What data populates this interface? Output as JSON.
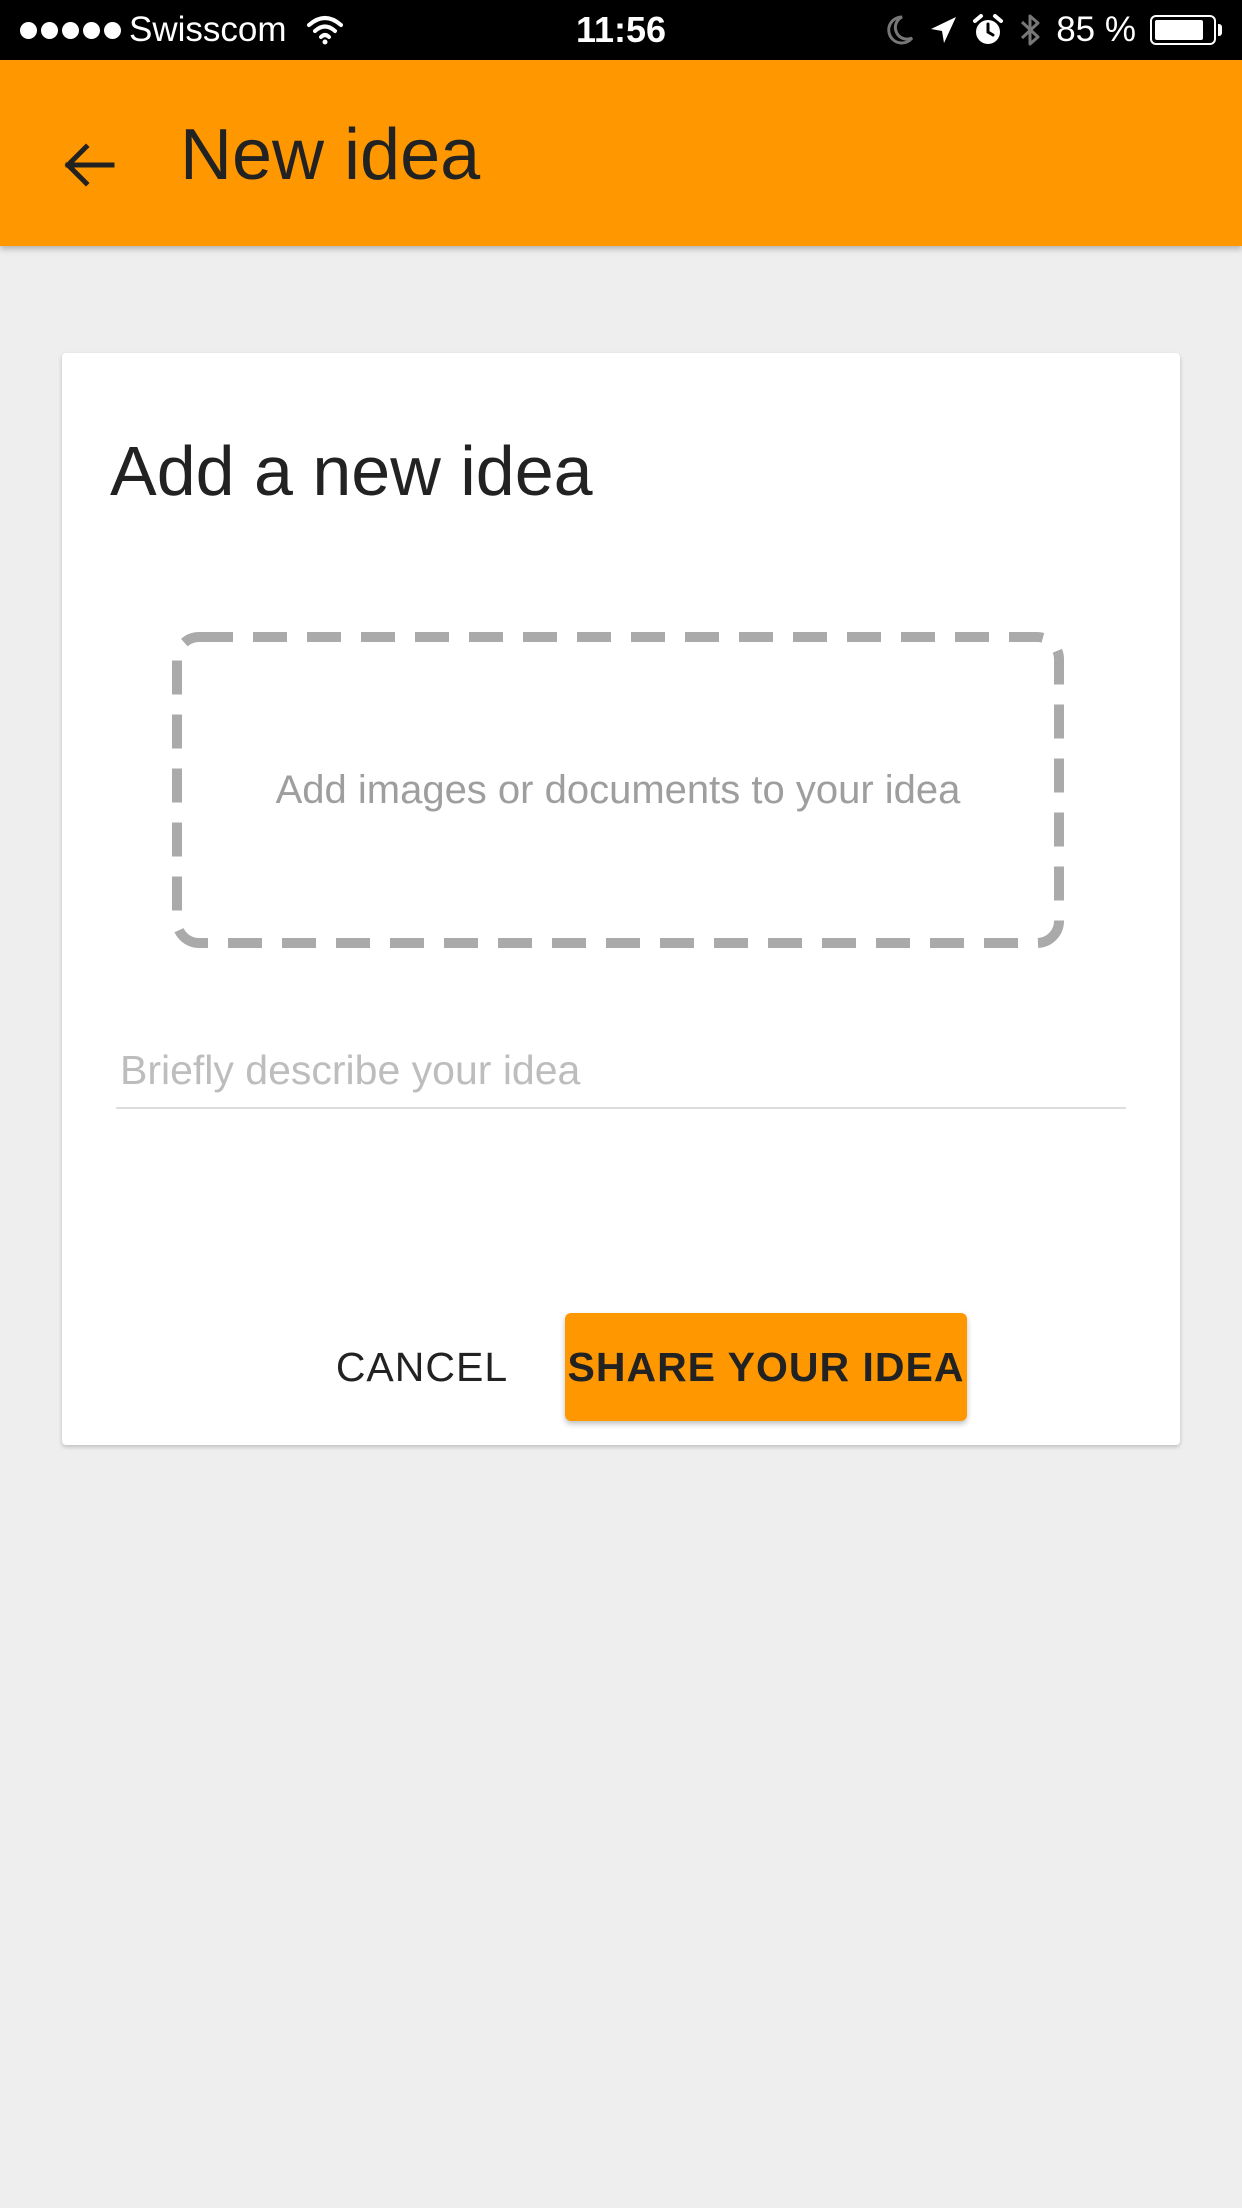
{
  "status_bar": {
    "carrier": "Swisscom",
    "time": "11:56",
    "battery_percent": "85 %",
    "battery_level": 0.85,
    "icons": [
      "signal-dots-icon",
      "wifi-icon",
      "moon-icon",
      "location-arrow-icon",
      "alarm-icon",
      "bluetooth-icon",
      "battery-icon"
    ]
  },
  "app_bar": {
    "title": "New idea",
    "back_icon": "arrow-left-icon",
    "color": "#ff9800"
  },
  "card": {
    "title": "Add a new idea",
    "dropzone_text": "Add images or documents to your idea",
    "description_placeholder": "Briefly describe your idea",
    "description_value": "",
    "cancel_label": "CANCEL",
    "share_label": "SHARE YOUR IDEA"
  },
  "colors": {
    "accent": "#ff9800",
    "background": "#eeeeee",
    "dropzone_border": "#aaaaaa"
  }
}
